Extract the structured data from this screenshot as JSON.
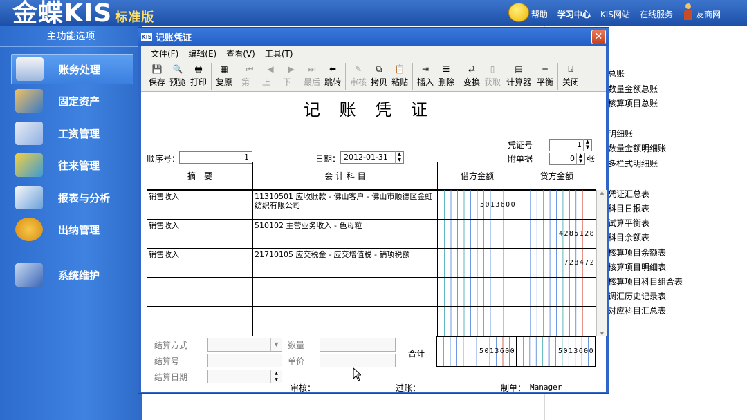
{
  "app": {
    "logo_text": "金蝶KIS",
    "edition": "标准版",
    "nav": [
      "帮助",
      "学习中心",
      "KIS网站",
      "在线服务",
      "友商网"
    ]
  },
  "sidebar": {
    "title": "主功能选项",
    "items": [
      {
        "label": "账务处理",
        "icon": "ledger-icon",
        "active": true
      },
      {
        "label": "固定资产",
        "icon": "asset-icon",
        "active": false
      },
      {
        "label": "工资管理",
        "icon": "salary-icon",
        "active": false
      },
      {
        "label": "往来管理",
        "icon": "transfer-icon",
        "active": false
      },
      {
        "label": "报表与分析",
        "icon": "report-icon",
        "active": false
      },
      {
        "label": "出纳管理",
        "icon": "cashier-icon",
        "active": false
      },
      {
        "label": "系统维护",
        "icon": "maintenance-icon",
        "active": false
      }
    ]
  },
  "reports": [
    "总账",
    "数量金额总账",
    "核算项目总账",
    "明细账",
    "数量金额明细账",
    "多栏式明细账",
    "凭证汇总表",
    "科目日报表",
    "试算平衡表",
    "科目余额表",
    "核算项目余额表",
    "核算项目明细表",
    "核算项目科目组合表",
    "调汇历史记录表",
    "对应科目汇总表"
  ],
  "dialog": {
    "title": "记账凭证",
    "menu": [
      "文件(F)",
      "编辑(E)",
      "查看(V)",
      "工具(T)"
    ],
    "toolbar": [
      {
        "label": "保存",
        "icon": "save-icon",
        "enabled": true
      },
      {
        "label": "预览",
        "icon": "preview-icon",
        "enabled": true
      },
      {
        "label": "打印",
        "icon": "print-icon",
        "enabled": true
      },
      {
        "label": "复原",
        "icon": "restore-icon",
        "enabled": true
      },
      {
        "label": "第一",
        "icon": "first-icon",
        "enabled": false
      },
      {
        "label": "上一",
        "icon": "prev-icon",
        "enabled": false
      },
      {
        "label": "下一",
        "icon": "next-icon",
        "enabled": false
      },
      {
        "label": "最后",
        "icon": "last-icon",
        "enabled": false
      },
      {
        "label": "跳转",
        "icon": "jump-icon",
        "enabled": true
      },
      {
        "label": "审核",
        "icon": "audit-icon",
        "enabled": false
      },
      {
        "label": "拷贝",
        "icon": "copy-icon",
        "enabled": true
      },
      {
        "label": "粘贴",
        "icon": "paste-icon",
        "enabled": true
      },
      {
        "label": "插入",
        "icon": "insert-icon",
        "enabled": true
      },
      {
        "label": "删除",
        "icon": "delete-icon",
        "enabled": true
      },
      {
        "label": "变换",
        "icon": "switch-icon",
        "enabled": true
      },
      {
        "label": "获取",
        "icon": "fetch-icon",
        "enabled": false
      },
      {
        "label": "计算器",
        "icon": "calculator-icon",
        "enabled": true
      },
      {
        "label": "平衡",
        "icon": "balance-icon",
        "enabled": true
      },
      {
        "label": "关闭",
        "icon": "close-door-icon",
        "enabled": true
      }
    ],
    "voucher": {
      "heading": "记 账 凭 证",
      "seq_label": "顺序号：",
      "seq_value": "1",
      "date_label": "日期：",
      "date_value": "2012-01-31",
      "voucher_no_label": "凭证号",
      "voucher_no_value": "1",
      "attach_label": "附单据",
      "attach_value": "0",
      "attach_unit": "张",
      "headers": {
        "summary": "摘　要",
        "account": "会 计 科 目",
        "debit": "借方金额",
        "credit": "贷方金额"
      },
      "rows": [
        {
          "summary": "销售收入",
          "account": "11310501 应收账款 - 佛山客户 - 佛山市顺德区金虹纺织有限公司",
          "debit": "5013600",
          "credit": ""
        },
        {
          "summary": "销售收入",
          "account": "510102 主营业务收入 - 色母粒",
          "debit": "",
          "credit": "4285128"
        },
        {
          "summary": "销售收入",
          "account": "21710105 应交税金 - 应交增值税 - 销项税额",
          "debit": "",
          "credit": "728472"
        },
        {
          "summary": "",
          "account": "",
          "debit": "",
          "credit": ""
        },
        {
          "summary": "",
          "account": "",
          "debit": "",
          "credit": ""
        }
      ],
      "footer": {
        "settle_method": "结算方式",
        "settle_no": "结算号",
        "settle_date": "结算日期",
        "quantity": "数量",
        "unit_price": "单价",
        "total_label": "合计",
        "total_debit": "5013600",
        "total_credit": "5013600"
      },
      "sign": {
        "audit": "审核：",
        "post": "过账：",
        "maker": "制单：",
        "maker_value": "Manager"
      }
    }
  },
  "colors": {
    "accent": "#2f66c7",
    "grid_blue": "#4a7fd8",
    "grid_red": "#d63a2a",
    "grid_teal": "#37a6b0"
  }
}
